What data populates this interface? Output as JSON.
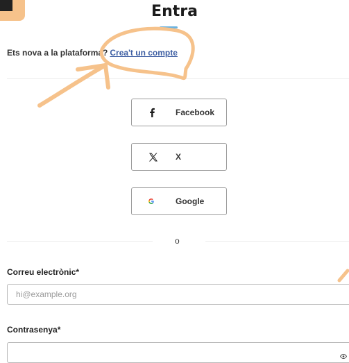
{
  "header": {
    "title": "Entra"
  },
  "signup": {
    "prompt": "Ets nova a la plataforma?",
    "link": "Crea't un compte"
  },
  "social": {
    "facebook": {
      "label": "Facebook",
      "icon": "facebook-icon"
    },
    "x": {
      "label": "X",
      "icon": "x-icon"
    },
    "google": {
      "label": "Google",
      "icon": "google-icon"
    }
  },
  "separator": {
    "text": "o"
  },
  "form": {
    "email": {
      "label": "Correu electrònic*",
      "placeholder": "hi@example.org",
      "value": ""
    },
    "password": {
      "label": "Contrasenya*",
      "placeholder": "",
      "value": ""
    }
  },
  "colors": {
    "annotation": "#f6c28b",
    "link": "#3e5fa3",
    "accent": "#6bb3e0"
  }
}
